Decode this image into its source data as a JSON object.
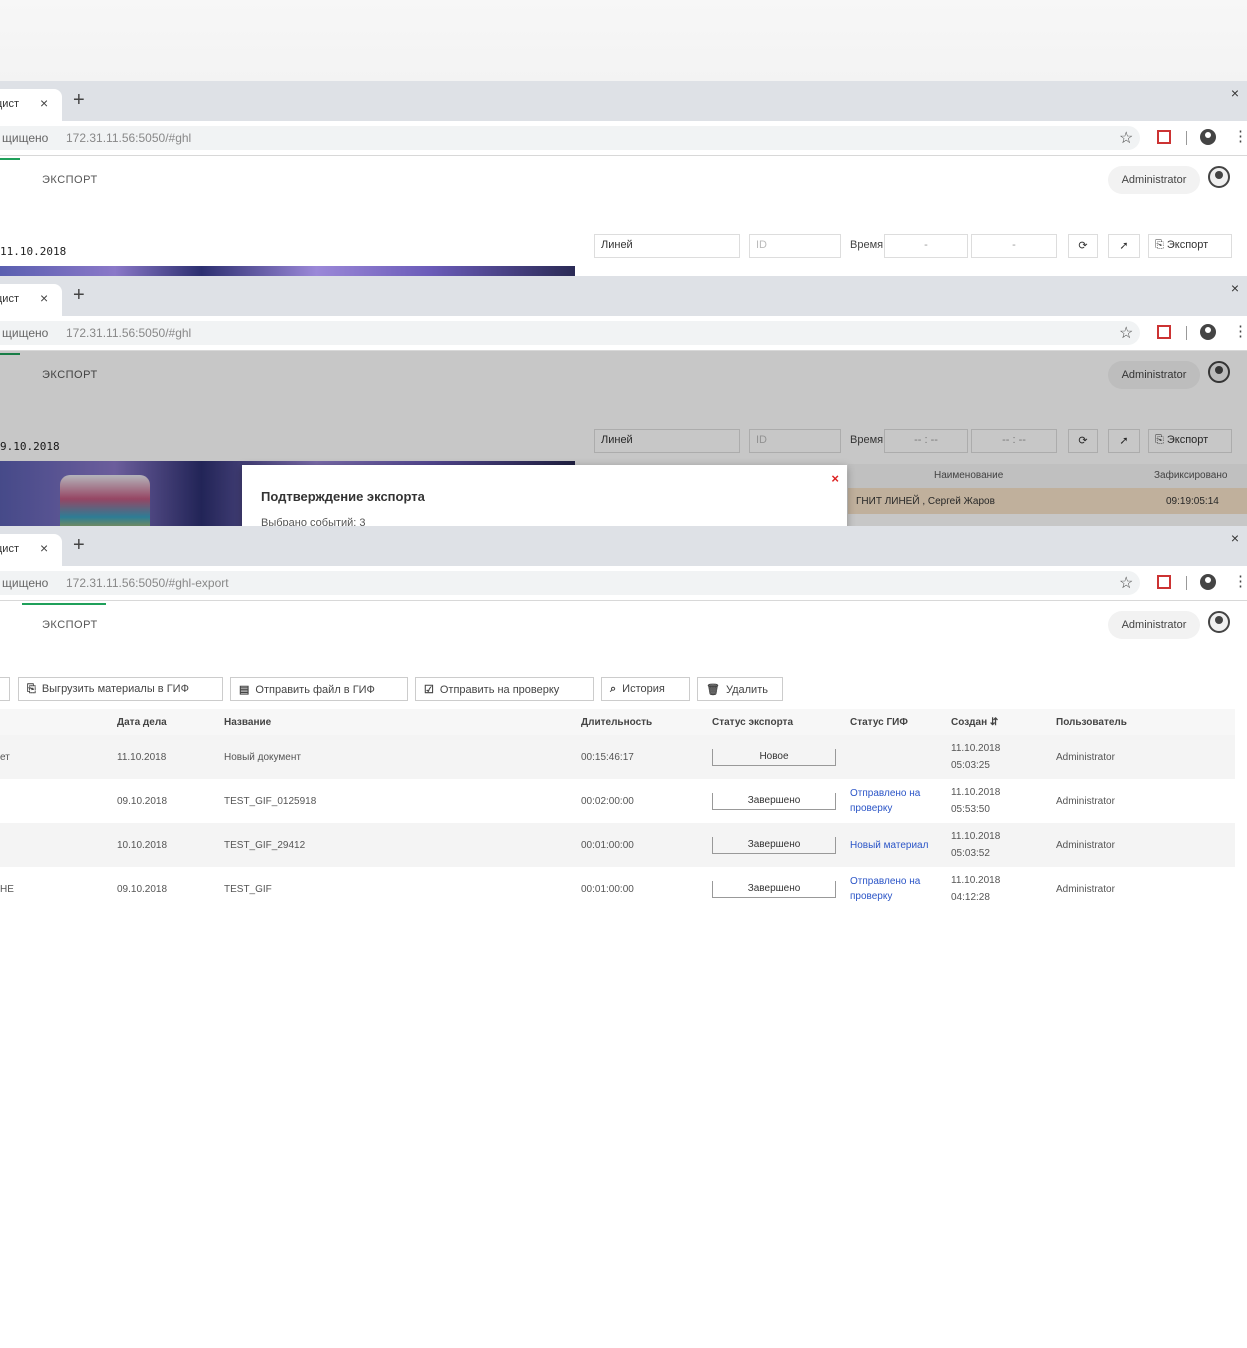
{
  "browser": {
    "tab_title": "цист",
    "tab_close": "×",
    "new_tab": "+",
    "window_close": "×",
    "security_label": "щищено",
    "url_1": "172.31.11.56:5050/#ghl",
    "url_2": "172.31.11.56:5050/#ghl",
    "url_3": "172.31.11.56:5050/#ghl-export",
    "star_icon": "star-icon",
    "menu_glyph": "⋮",
    "star_glyph": "☆"
  },
  "app": {
    "nav_export": "ЭКСПОРТ",
    "user": "Administrator",
    "accent": "#1fa05a"
  },
  "screen1": {
    "date": "11.10.2018",
    "lane_value": "Линей",
    "id_placeholder": "ID",
    "time_label": "Время",
    "time_from": "-",
    "time_to": "-",
    "refresh_glyph": "⟳",
    "pin_glyph": "➚",
    "export_button": "Экспорт"
  },
  "screen2": {
    "date": "9.10.2018",
    "lane_value": "Линей",
    "id_placeholder": "ID",
    "time_label": "Время",
    "time_from": "-- : --",
    "time_to": "-- : --",
    "export_button": "Экспорт",
    "modal_title": "Подтверждение экспорта",
    "modal_subtitle": "Выбрано событий: 3",
    "modal_close": "×",
    "col_name": "Наименование",
    "col_time": "Зафиксировано",
    "highlight_row_name": "ГНИТ ЛИНЕЙ , Сергей Жаров",
    "highlight_row_time": "09:19:05:14"
  },
  "screen3": {
    "toolbar": {
      "btn0": "",
      "btn1": "Выгрузить материалы в ГИФ",
      "btn2": "Отправить файл в ГИФ",
      "btn3": "Отправить на проверку",
      "btn4": "История",
      "btn5": "Удалить"
    },
    "columns": [
      "",
      "Дата дела",
      "Название",
      "Длительность",
      "Статус экспорта",
      "Статус ГИФ",
      "Создан",
      "Пользователь"
    ],
    "rows": [
      {
        "c0": "ет",
        "date": "11.10.2018",
        "name": "Новый документ",
        "dur": "00:15:46:17",
        "status": "Новое",
        "gif": "",
        "created_1": "11.10.2018",
        "created_2": "05:03:25",
        "user": "Administrator"
      },
      {
        "c0": "",
        "date": "09.10.2018",
        "name": "TEST_GIF_0125918",
        "dur": "00:02:00:00",
        "status": "Завершено",
        "gif": "Отправлено на проверку",
        "created_1": "11.10.2018",
        "created_2": "05:53:50",
        "user": "Administrator"
      },
      {
        "c0": "",
        "date": "10.10.2018",
        "name": "TEST_GIF_29412",
        "dur": "00:01:00:00",
        "status": "Завершено",
        "gif": "Новый материал",
        "created_1": "11.10.2018",
        "created_2": "05:03:52",
        "user": "Administrator"
      },
      {
        "c0": "НЕ",
        "date": "09.10.2018",
        "name": "TEST_GIF",
        "dur": "00:01:00:00",
        "status": "Завершено",
        "gif": "Отправлено на проверку",
        "created_1": "11.10.2018",
        "created_2": "04:12:28",
        "user": "Administrator"
      }
    ]
  }
}
